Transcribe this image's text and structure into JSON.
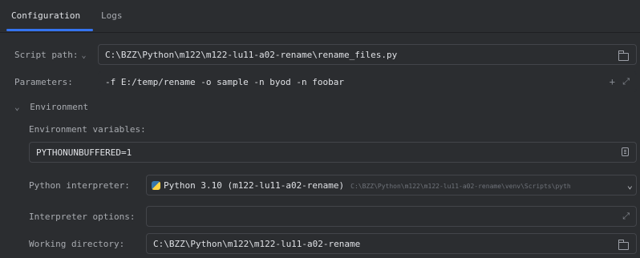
{
  "tabs": [
    {
      "label": "Configuration",
      "active": true
    },
    {
      "label": "Logs",
      "active": false
    }
  ],
  "script_path": {
    "label": "Script path:",
    "value": "C:\\BZZ\\Python\\m122\\m122-lu11-a02-rename\\rename_files.py"
  },
  "parameters": {
    "label": "Parameters:",
    "value": "-f E:/temp/rename -o sample -n byod -n foobar"
  },
  "environment": {
    "section_label": "Environment",
    "env_vars_label": "Environment variables:",
    "env_vars_value": "PYTHONUNBUFFERED=1",
    "interpreter_label": "Python interpreter:",
    "interpreter_name": "Python 3.10 (m122-lu11-a02-rename)",
    "interpreter_path": "C:\\BZZ\\Python\\m122\\m122-lu11-a02-rename\\venv\\Scripts\\pyth",
    "interpreter_options_label": "Interpreter options:",
    "interpreter_options_value": "",
    "working_dir_label": "Working directory:",
    "working_dir_value": "C:\\BZZ\\Python\\m122\\m122-lu11-a02-rename"
  },
  "colors": {
    "background": "#2b2d30",
    "accent": "#3574f0",
    "border": "#43454a"
  }
}
